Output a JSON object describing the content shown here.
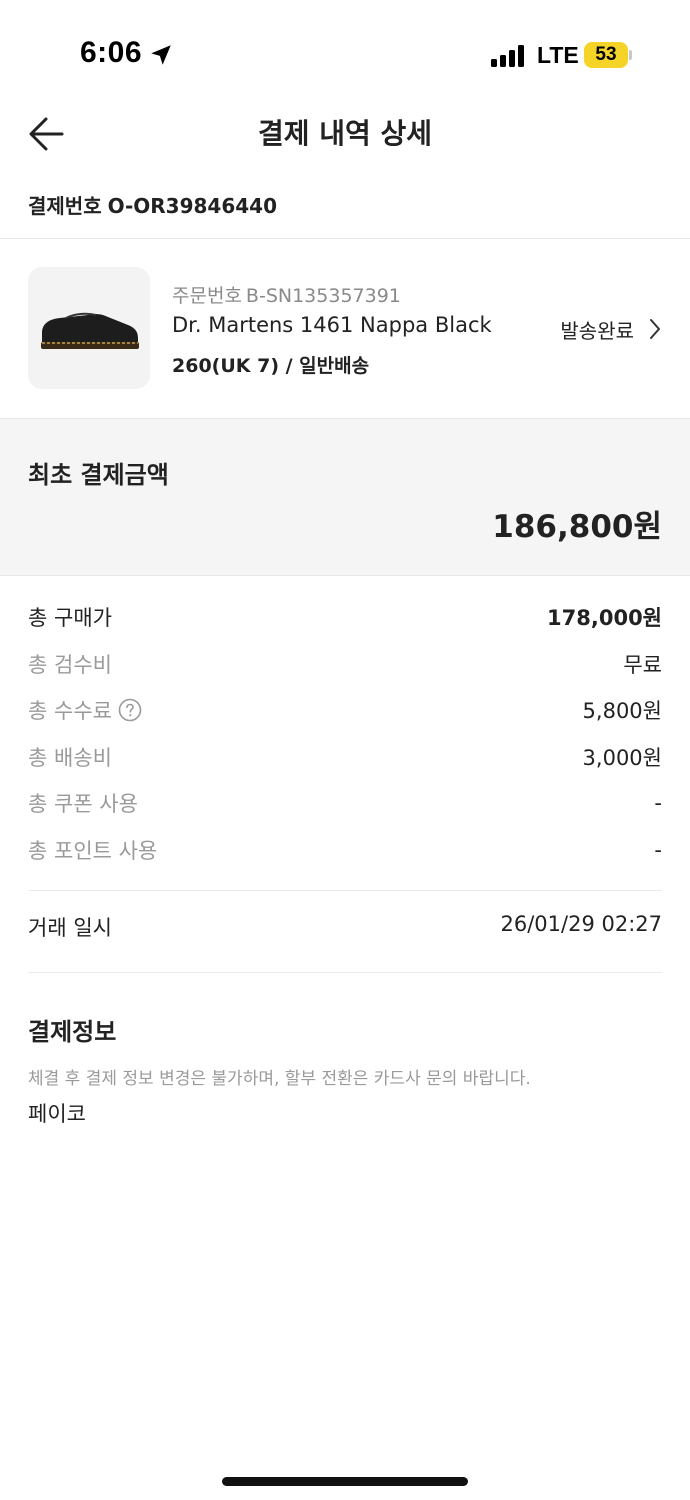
{
  "status_bar": {
    "time": "6:06",
    "network": "LTE",
    "battery": "53"
  },
  "header": {
    "title": "결제 내역 상세",
    "back_icon": "arrow-left-icon"
  },
  "payment": {
    "number_label": "결제번호",
    "number_value": "O-OR39846440"
  },
  "product": {
    "order_label": "주문번호",
    "order_value": "B-SN135357391",
    "name": "Dr. Martens 1461 Nappa Black",
    "option": "260(UK 7) / 일반배송",
    "status": "발송완료"
  },
  "initial_payment": {
    "label": "최초 결제금액",
    "amount": "186,800원"
  },
  "breakdown": [
    {
      "label": "총 구매가",
      "value": "178,000원"
    },
    {
      "label": "총 검수비",
      "value": "무료"
    },
    {
      "label": "총 수수료",
      "value": "5,800원"
    },
    {
      "label": "총 배송비",
      "value": "3,000원"
    },
    {
      "label": "총 쿠폰 사용",
      "value": "-"
    },
    {
      "label": "총 포인트 사용",
      "value": "-"
    }
  ],
  "trade": {
    "label": "거래 일시",
    "value": "26/01/29 02:27"
  },
  "payment_info": {
    "title": "결제정보",
    "notice": "체결 후 결제 정보 변경은 불가하며, 할부 전환은 카드사 문의 바랍니다.",
    "method": "페이코"
  }
}
